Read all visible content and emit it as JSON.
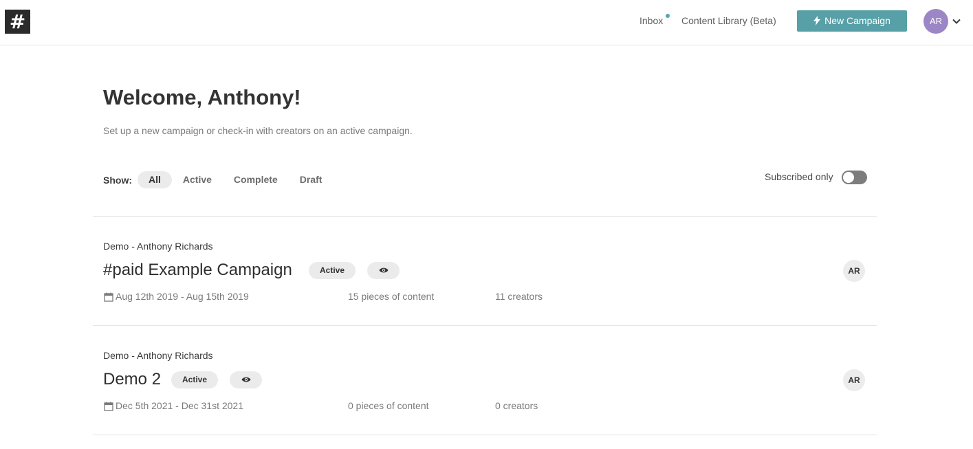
{
  "header": {
    "logo_glyph": "#",
    "nav_inbox": "Inbox",
    "nav_content_library": "Content Library (Beta)",
    "new_campaign_label": "New Campaign",
    "user_initials": "AR",
    "accent_color": "#57a0a7"
  },
  "main": {
    "title": "Welcome, Anthony!",
    "subtitle": "Set up a new campaign or check-in with creators on an active campaign."
  },
  "filters": {
    "label": "Show:",
    "options": [
      "All",
      "Active",
      "Complete",
      "Draft"
    ],
    "selected": "All",
    "subscribed_label": "Subscribed only",
    "subscribed_on": false
  },
  "campaigns": [
    {
      "org": "Demo - Anthony Richards",
      "title": "#paid Example Campaign",
      "status": "Active",
      "dates": "Aug 12th 2019 - Aug 15th 2019",
      "content": "15 pieces of content",
      "creators": "11 creators",
      "owner_initials": "AR"
    },
    {
      "org": "Demo - Anthony Richards",
      "title": "Demo 2",
      "status": "Active",
      "dates": "Dec 5th 2021 - Dec 31st 2021",
      "content": "0 pieces of content",
      "creators": "0 creators",
      "owner_initials": "AR"
    }
  ],
  "icons": {
    "logo": "hash-logo-icon",
    "new_campaign": "lightning-bolt-icon",
    "user_menu": "chevron-down-icon",
    "visibility": "eye-icon",
    "dates": "calendar-icon"
  }
}
